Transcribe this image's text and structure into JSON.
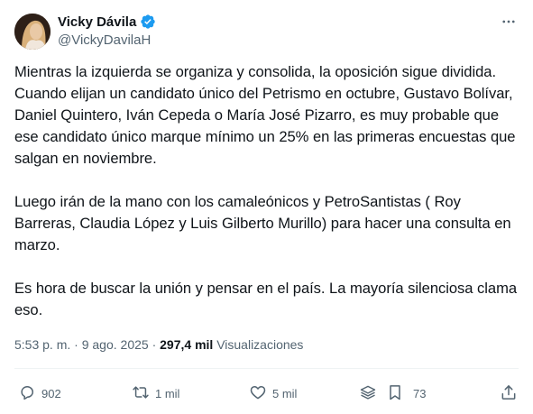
{
  "author": {
    "display_name": "Vicky Dávila",
    "handle": "@VickyDavilaH",
    "verified": true
  },
  "tweet": {
    "paragraphs": [
      "Mientras la izquierda se organiza y consolida, la oposición sigue dividida. Cuando elijan un candidato único del Petrismo en octubre, Gustavo Bolívar, Daniel Quintero, Iván Cepeda o María José Pizarro, es muy probable que ese candidato único marque mínimo un 25% en las primeras encuestas que salgan en noviembre.",
      "Luego irán de la mano con los camaleónicos y PetroSantistas ( Roy Barreras, Claudia López y Luis Gilberto Murillo) para hacer una consulta en marzo.",
      "Es hora de buscar la unión y pensar en el país. La mayoría silenciosa clama eso."
    ],
    "time": "5:53 p. m.",
    "separator": "·",
    "date": "9 ago. 2025",
    "views_count": "297,4 mil",
    "views_label": "Visualizaciones"
  },
  "actions": {
    "replies": "902",
    "retweets": "1 mil",
    "likes": "5 mil",
    "bookmarks": "73"
  },
  "colors": {
    "text": "#0f1419",
    "secondary": "#536471",
    "verified": "#1d9bf0",
    "divider": "#eff3f4"
  },
  "icons": [
    "verified-badge-icon",
    "more-options-icon",
    "reply-icon",
    "retweet-icon",
    "like-icon",
    "grok-stack-icon",
    "bookmark-icon",
    "share-icon"
  ]
}
